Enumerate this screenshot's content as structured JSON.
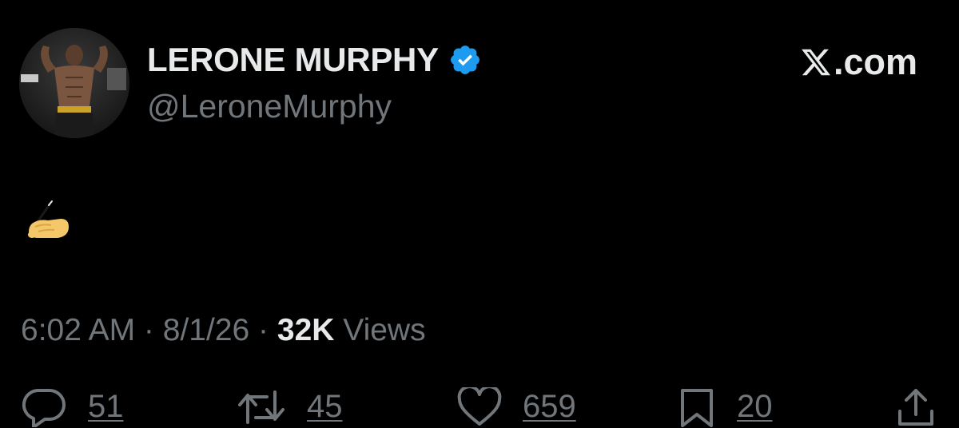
{
  "author": {
    "display_name": "LERONE MURPHY",
    "handle": "@LeroneMurphy",
    "verified": true
  },
  "brand": {
    "domain": "X.com",
    "mark_icon": "x-logo-icon",
    "dotcom": ".com"
  },
  "tweet": {
    "text": "✍️"
  },
  "meta": {
    "time": "6:02 AM",
    "sep1": " · ",
    "date": "8/1/26",
    "sep2": " · ",
    "views_count": "32K",
    "views_label": " Views"
  },
  "actions": {
    "replies": "51",
    "reposts": "45",
    "likes": "659",
    "bookmarks": "20"
  },
  "colors": {
    "background": "#000000",
    "primary_text": "#e7e9ea",
    "secondary_text": "#71767b",
    "verified_badge": "#1d9bf0"
  }
}
